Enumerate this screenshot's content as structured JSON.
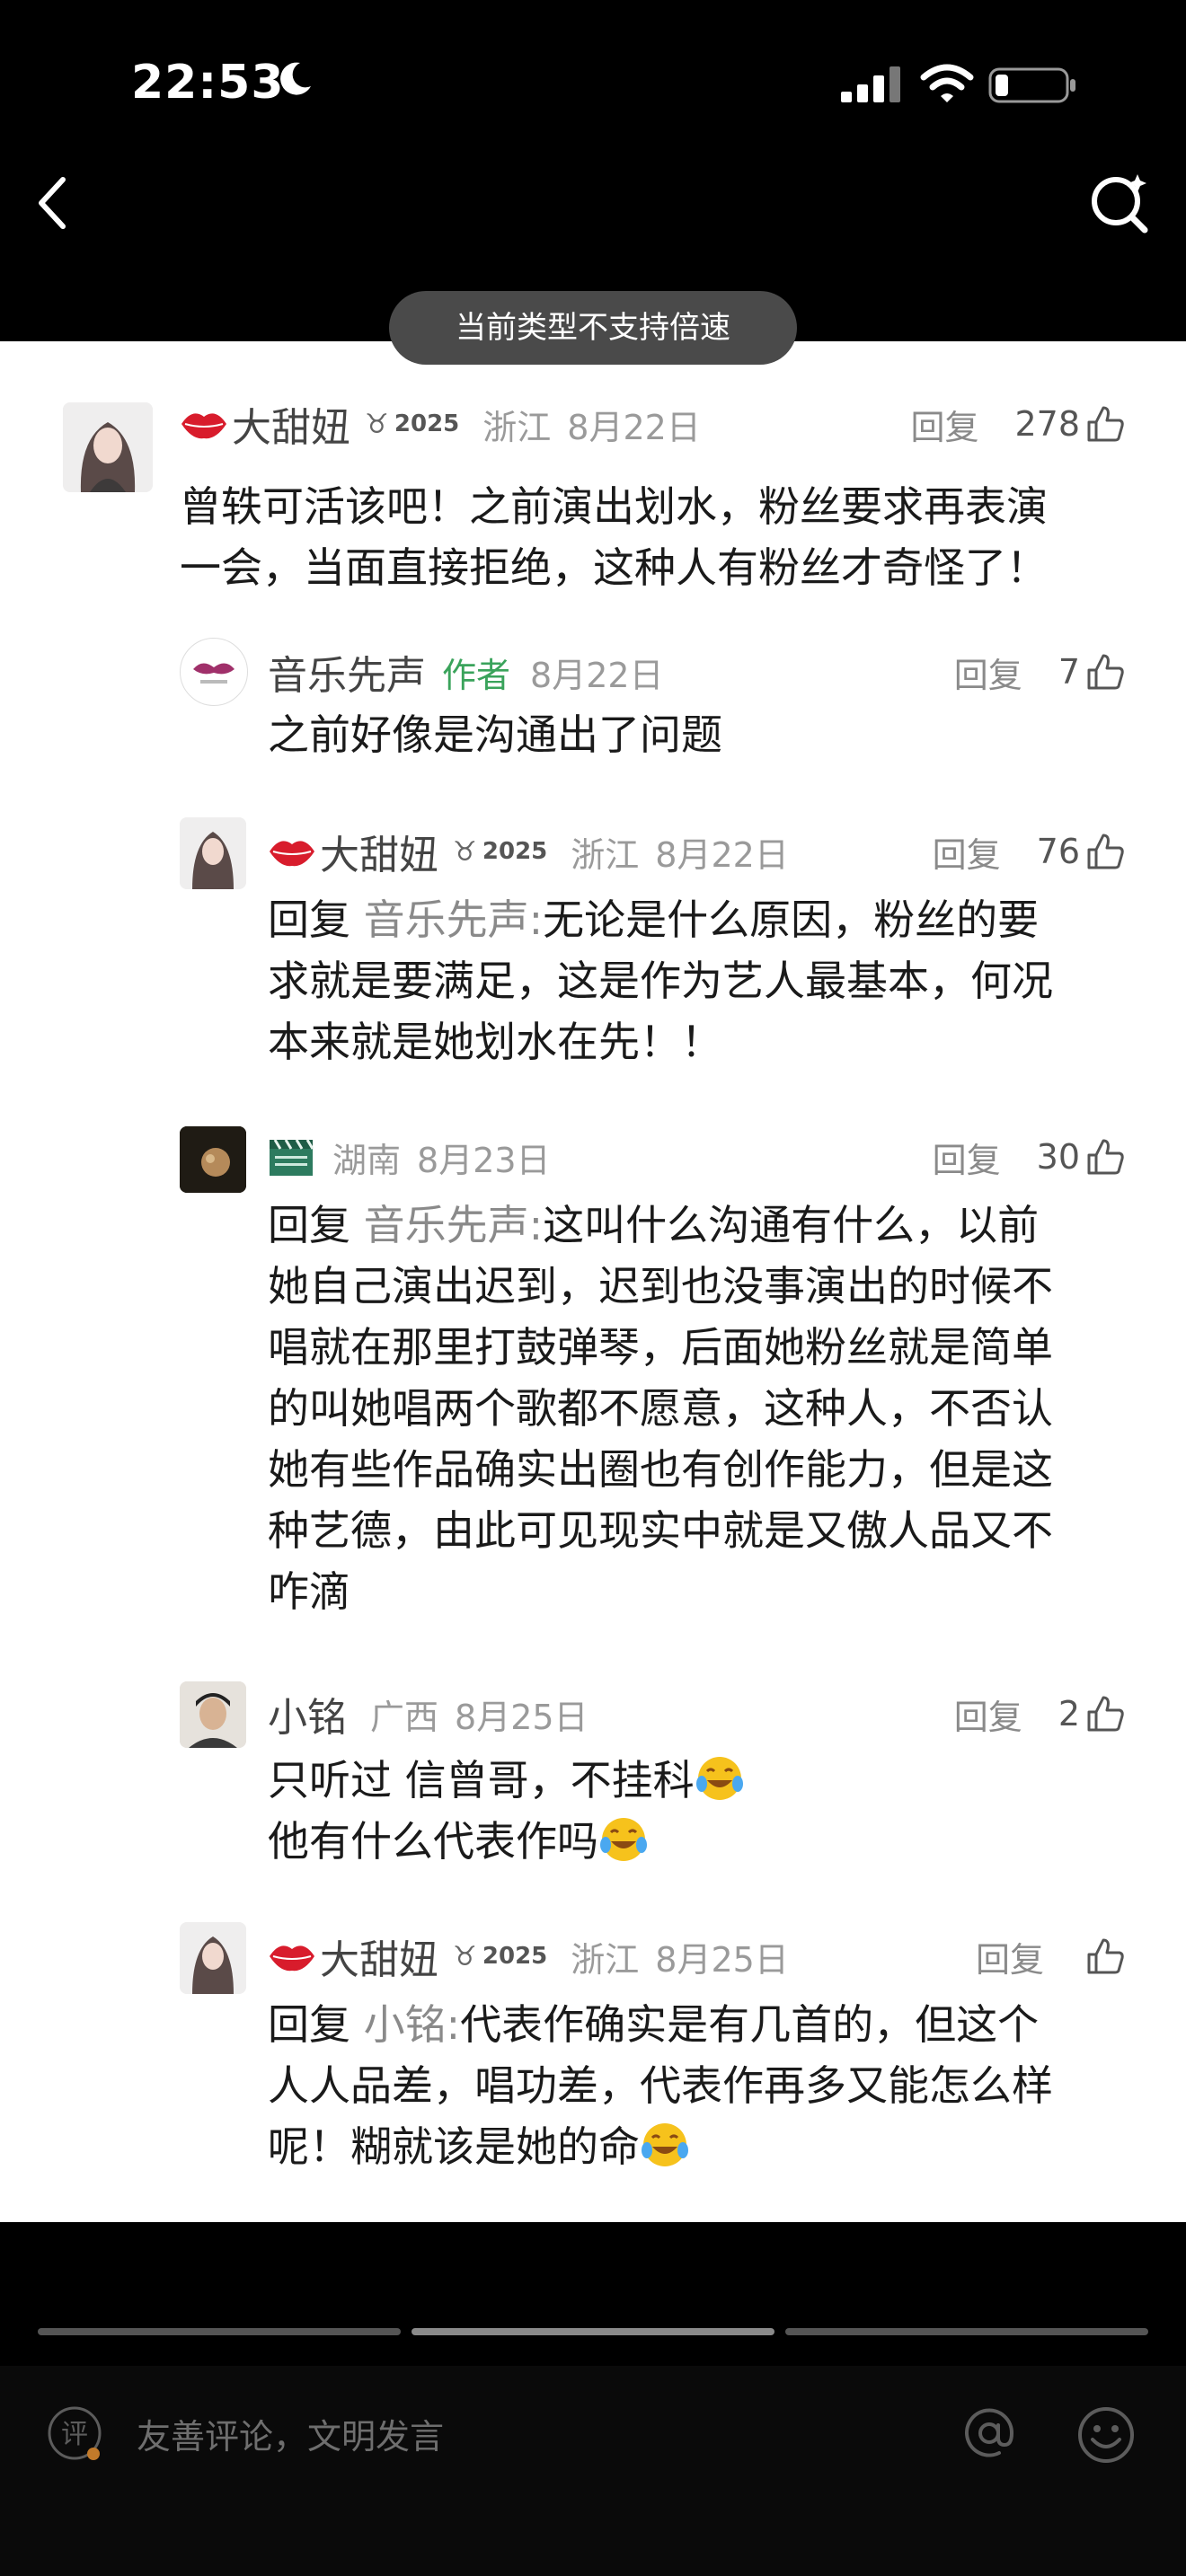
{
  "status_bar": {
    "time": "22:53"
  },
  "toast": "当前类型不支持倍速",
  "comments": [
    {
      "username": "大甜妞",
      "badge_year": "2025",
      "location": "浙江",
      "date": "8月22日",
      "reply_label": "回复",
      "likes": "278",
      "lines": [
        "曾轶可活该吧！之前演出划水，粉丝要求再表演",
        "一会，当面直接拒绝，这种人有粉丝才奇怪了！"
      ]
    },
    {
      "username": "音乐先声",
      "author_tag": "作者",
      "date": "8月22日",
      "reply_label": "回复",
      "likes": "7",
      "lines": [
        "之前好像是沟通出了问题"
      ]
    },
    {
      "username": "大甜妞",
      "badge_year": "2025",
      "location": "浙江",
      "date": "8月22日",
      "reply_label": "回复",
      "likes": "76",
      "reply_prefix": "回复",
      "reply_to": "音乐先声:",
      "lines": [
        "无论是什么原因，粉丝的要",
        "求就是要满足，这是作为艺人最基本，何况",
        "本来就是她划水在先！！"
      ]
    },
    {
      "location": "湖南",
      "date": "8月23日",
      "reply_label": "回复",
      "likes": "30",
      "reply_prefix": "回复",
      "reply_to": "音乐先声:",
      "lines": [
        "这叫什么沟通有什么，以前",
        "她自己演出迟到，迟到也没事演出的时候不",
        "唱就在那里打鼓弹琴，后面她粉丝就是简单",
        "的叫她唱两个歌都不愿意，这种人，不否认",
        "她有些作品确实出圈也有创作能力，但是这",
        "种艺德，由此可见现实中就是又傲人品又不",
        "咋滴"
      ]
    },
    {
      "username": "小铭",
      "location": "广西",
      "date": "8月25日",
      "reply_label": "回复",
      "likes": "2",
      "lines": [
        "只听过 信曾哥，不挂科",
        "他有什么代表作吗"
      ]
    },
    {
      "username": "大甜妞",
      "badge_year": "2025",
      "location": "浙江",
      "date": "8月25日",
      "reply_label": "回复",
      "reply_prefix": "回复",
      "reply_to": "小铭:",
      "lines": [
        "代表作确实是有几首的，但这个",
        "人人品差，唱功差，代表作再多又能怎么样",
        "呢！糊就该是她的命"
      ]
    }
  ],
  "input_bar": {
    "placeholder": "友善评论，文明发言",
    "ping_glyph": "评"
  },
  "colors": {
    "author_tag": "#3aa35b",
    "lips": "#d81c2c",
    "toast_bg": "#4a4a4a"
  },
  "icons": [
    "back-icon",
    "search-icon",
    "thumb-up-icon",
    "at-icon",
    "emoji-icon",
    "lips-icon",
    "medal-icon",
    "clapperboard-icon",
    "crying-laughing-emoji"
  ]
}
